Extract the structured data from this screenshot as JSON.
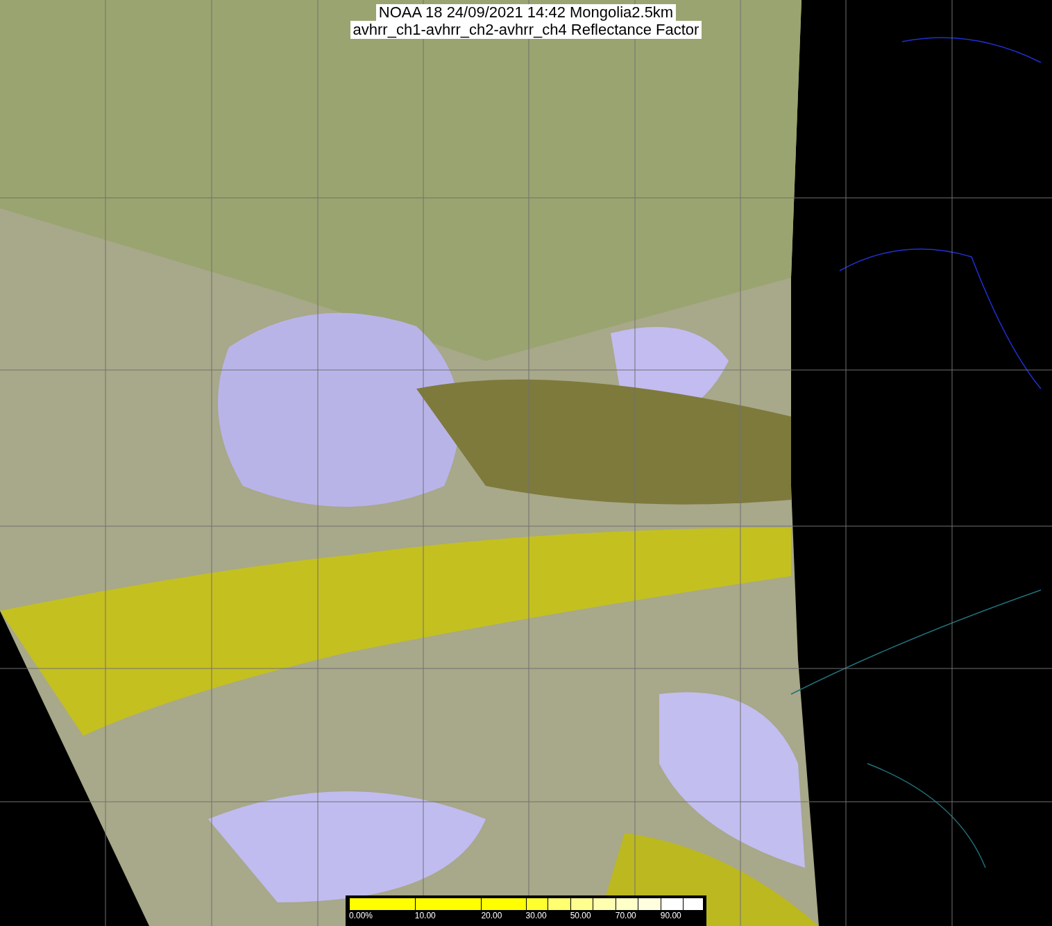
{
  "title": {
    "line_1": "NOAA 18 24/09/2021 14:42 Mongolia2.5km",
    "line_2": "avhrr_ch1-avhrr_ch2-avhrr_ch4 Reflectance Factor"
  },
  "colorbar": {
    "segments": [
      {
        "color": "#ffff00",
        "label": "0.00%"
      },
      {
        "color": "#ffff00",
        "label": "10.00"
      },
      {
        "color": "#ffff00",
        "label": "20.00"
      },
      {
        "color": "#ffff30",
        "label": "30.00"
      },
      {
        "color": "#ffff70"
      },
      {
        "color": "#ffff90",
        "label": "50.00"
      },
      {
        "color": "#ffffb0"
      },
      {
        "color": "#ffffc8",
        "label": "70.00"
      },
      {
        "color": "#ffffe0"
      },
      {
        "color": "#ffffff",
        "label": "90.00"
      },
      {
        "color": "#ffffff"
      }
    ]
  }
}
